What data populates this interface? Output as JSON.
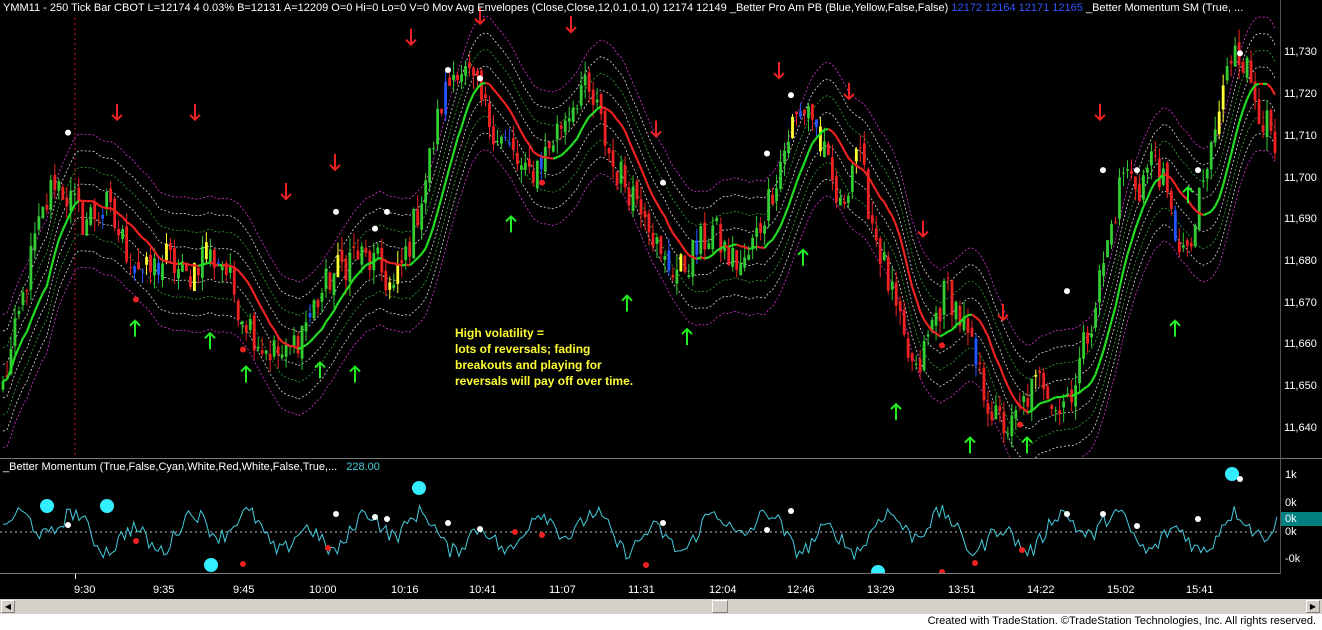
{
  "header": {
    "symbol_info": "YMM11 - 250 Tick Bar  CBOT  L=12174  4  0.03%  B=12131  A=12209  O=0  Hi=0  Lo=0  V=0",
    "envelope_label": "Mov Avg Envelopes (Close,Close,12,0.1,0.1,0)",
    "envelope_values": "12174   12149",
    "pro_am_label": "_Better Pro Am PB (Blue,Yellow,False,False)",
    "pro_am_values": "12172  12164  12171  12165",
    "momentum_label": "_Better Momentum SM (True, ..."
  },
  "colors": {
    "background": "#000000",
    "up_bar": "#33cc33",
    "down_bar": "#ee2222",
    "blue_bar": "#2255ff",
    "yellow_bar": "#ffff33",
    "ma_green": "#22dd22",
    "ma_red": "#ee2222",
    "envelope_magenta": "#dd33dd",
    "envelope_white": "#dddddd",
    "envelope_green": "#33aa33",
    "momentum_line": "#44ccdd",
    "cyan_dot": "#33eeff",
    "arrow_up": "#22ee22",
    "arrow_down": "#ee2222",
    "annotation": "#ffff33",
    "axis_highlight": "#008080"
  },
  "price_axis": {
    "labels": [
      "11,730",
      "11,720",
      "11,710",
      "11,700",
      "11,690",
      "11,680",
      "11,670",
      "11,660",
      "11,650",
      "11,640"
    ],
    "values": [
      11730,
      11720,
      11710,
      11700,
      11690,
      11680,
      11670,
      11660,
      11650,
      11640
    ]
  },
  "annotation": {
    "line1": "High volatility =",
    "line2": "lots of reversals; fading",
    "line3": "breakouts and playing for",
    "line4": "reversals will pay off over time."
  },
  "sub_panel": {
    "label": "_Better Momentum (True,False,Cyan,White,Red,White,False,True,...",
    "value": "228.00",
    "axis_labels": [
      "1k",
      "0k",
      "0k",
      "0k",
      "-0k"
    ],
    "highlighted_label": "0k"
  },
  "time_axis": {
    "labels": [
      "9:30",
      "9:35",
      "9:45",
      "10:00",
      "10:16",
      "10:41",
      "11:07",
      "11:31",
      "12:04",
      "12:46",
      "13:29",
      "13:51",
      "14:22",
      "15:02",
      "15:41"
    ]
  },
  "chart_data": {
    "type": "candlestick",
    "title": "YMM11 - 250 Tick Bar",
    "ylabel": "",
    "ylim": [
      11633,
      11738
    ],
    "anchors": [
      [
        0,
        11650
      ],
      [
        3,
        11662
      ],
      [
        8,
        11685
      ],
      [
        13,
        11700
      ],
      [
        16,
        11696
      ],
      [
        20,
        11690
      ],
      [
        26,
        11693
      ],
      [
        31,
        11683
      ],
      [
        36,
        11677
      ],
      [
        41,
        11681
      ],
      [
        46,
        11676
      ],
      [
        50,
        11682
      ],
      [
        55,
        11680
      ],
      [
        60,
        11668
      ],
      [
        65,
        11660
      ],
      [
        71,
        11657
      ],
      [
        76,
        11666
      ],
      [
        82,
        11676
      ],
      [
        88,
        11682
      ],
      [
        94,
        11679
      ],
      [
        98,
        11673
      ],
      [
        102,
        11685
      ],
      [
        106,
        11700
      ],
      [
        110,
        11718
      ],
      [
        114,
        11728
      ],
      [
        118,
        11722
      ],
      [
        122,
        11714
      ],
      [
        127,
        11707
      ],
      [
        131,
        11700
      ],
      [
        136,
        11706
      ],
      [
        141,
        11715
      ],
      [
        145,
        11722
      ],
      [
        149,
        11716
      ],
      [
        153,
        11703
      ],
      [
        157,
        11698
      ],
      [
        161,
        11694
      ],
      [
        165,
        11680
      ],
      [
        170,
        11678
      ],
      [
        174,
        11683
      ],
      [
        178,
        11688
      ],
      [
        182,
        11681
      ],
      [
        186,
        11679
      ],
      [
        190,
        11689
      ],
      [
        194,
        11701
      ],
      [
        198,
        11713
      ],
      [
        202,
        11718
      ],
      [
        206,
        11705
      ],
      [
        210,
        11692
      ],
      [
        214,
        11708
      ],
      [
        218,
        11690
      ],
      [
        222,
        11675
      ],
      [
        226,
        11660
      ],
      [
        229,
        11652
      ],
      [
        233,
        11665
      ],
      [
        237,
        11674
      ],
      [
        241,
        11664
      ],
      [
        245,
        11652
      ],
      [
        249,
        11642
      ],
      [
        253,
        11640
      ],
      [
        257,
        11648
      ],
      [
        261,
        11652
      ],
      [
        265,
        11645
      ],
      [
        269,
        11652
      ],
      [
        273,
        11667
      ],
      [
        277,
        11684
      ],
      [
        281,
        11702
      ],
      [
        285,
        11698
      ],
      [
        289,
        11706
      ],
      [
        293,
        11690
      ],
      [
        297,
        11680
      ],
      [
        301,
        11698
      ],
      [
        305,
        11716
      ],
      [
        309,
        11734
      ],
      [
        313,
        11723
      ],
      [
        317,
        11712
      ],
      [
        320,
        11702
      ]
    ],
    "bar_count": 320,
    "down_arrows": [
      [
        117,
        11716
      ],
      [
        195,
        11716
      ],
      [
        286,
        11697
      ],
      [
        335,
        11704
      ],
      [
        411,
        11734
      ],
      [
        480,
        11739
      ],
      [
        571,
        11737
      ],
      [
        656,
        11712
      ],
      [
        779,
        11726
      ],
      [
        849,
        11721
      ],
      [
        923,
        11688
      ],
      [
        1003,
        11668
      ],
      [
        1100,
        11716
      ]
    ],
    "up_arrows": [
      [
        135,
        11664
      ],
      [
        210,
        11661
      ],
      [
        246,
        11653
      ],
      [
        320,
        11654
      ],
      [
        355,
        11653
      ],
      [
        511,
        11689
      ],
      [
        627,
        11670
      ],
      [
        687,
        11662
      ],
      [
        803,
        11681
      ],
      [
        896,
        11644
      ],
      [
        970,
        11636
      ],
      [
        1027,
        11636
      ],
      [
        1175,
        11664
      ],
      [
        1188,
        11696
      ]
    ],
    "white_dots": [
      [
        68,
        11711
      ],
      [
        336,
        11692
      ],
      [
        375,
        11688
      ],
      [
        387,
        11692
      ],
      [
        448,
        11726
      ],
      [
        480,
        11724
      ],
      [
        663,
        11699
      ],
      [
        767,
        11706
      ],
      [
        791,
        11720
      ],
      [
        1067,
        11673
      ],
      [
        1103,
        11702
      ],
      [
        1137,
        11702
      ],
      [
        1198,
        11702
      ],
      [
        1240,
        11730
      ]
    ],
    "red_dots": [
      [
        136,
        11671
      ],
      [
        243,
        11659
      ],
      [
        542,
        11699
      ],
      [
        942,
        11660
      ],
      [
        1020,
        11641
      ]
    ]
  },
  "footer": {
    "text": "Created with TradeStation. ©TradeStation Technologies, Inc. All rights reserved."
  }
}
